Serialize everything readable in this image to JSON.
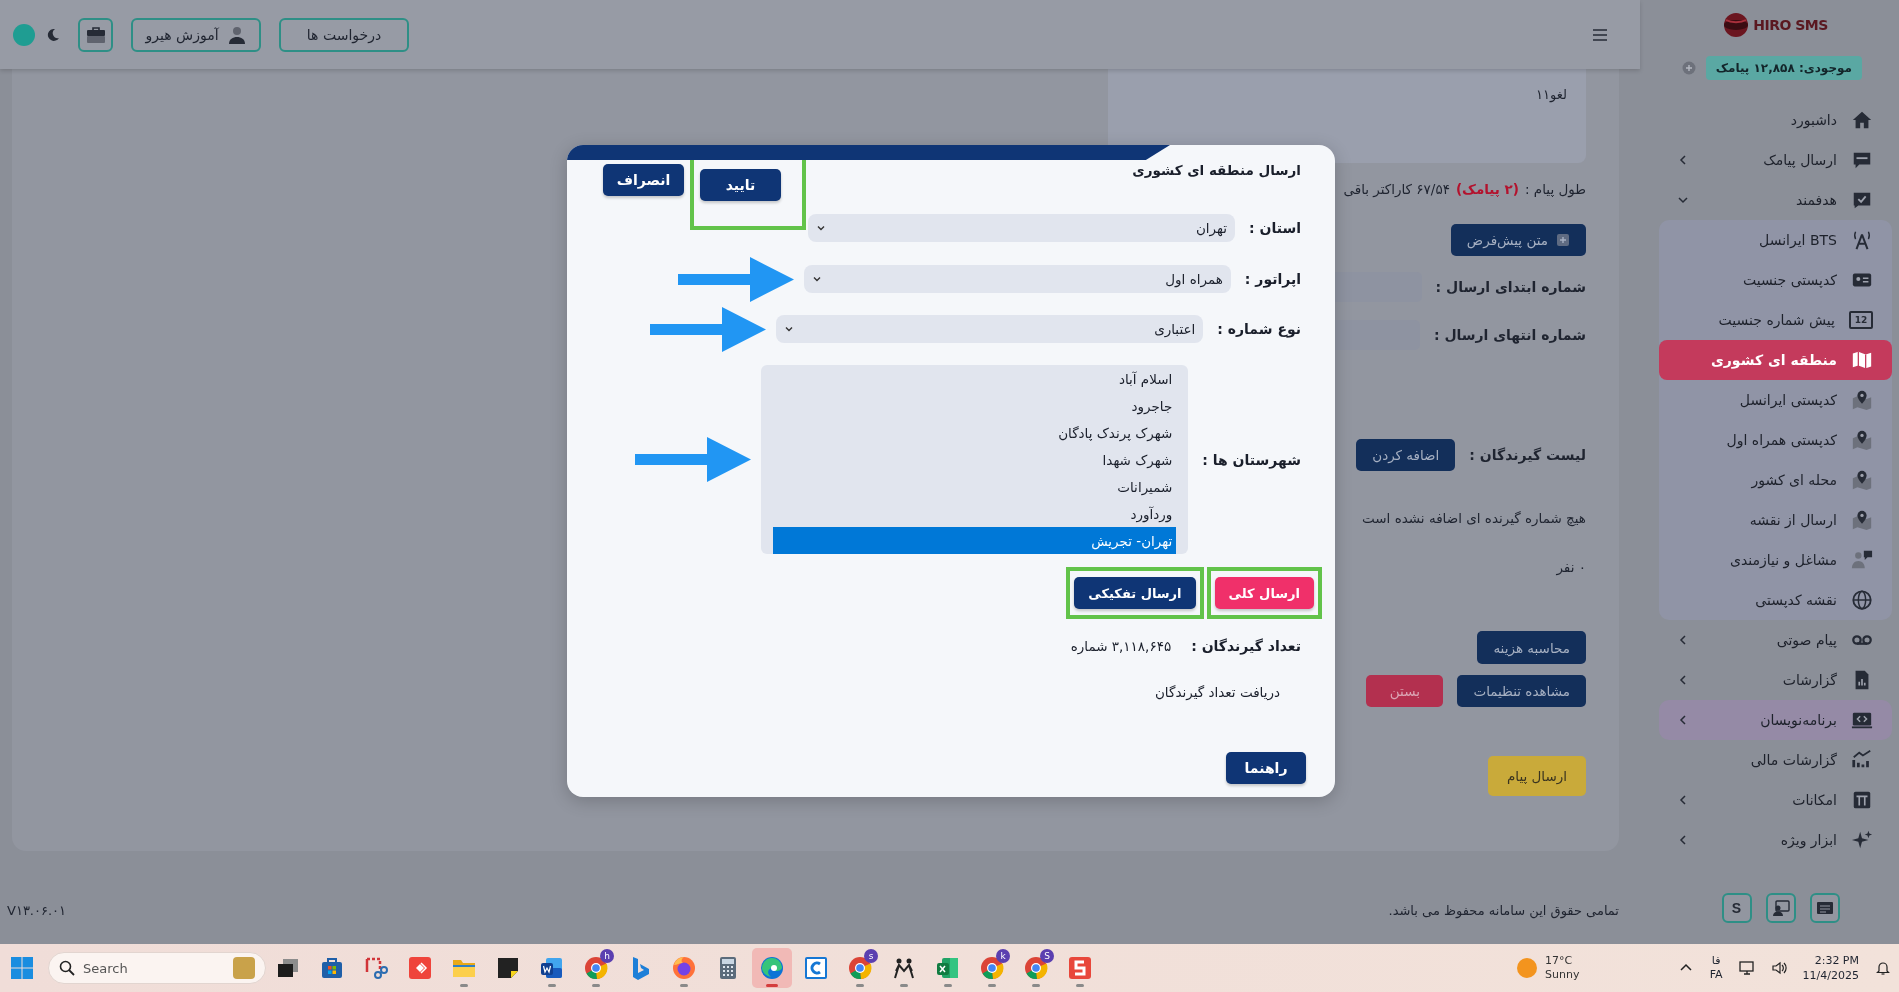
{
  "header": {
    "buttons": [
      {
        "kind": "text",
        "label": "درخواست ها"
      },
      {
        "kind": "user",
        "label": "آموزش هیرو"
      },
      {
        "kind": "briefcase"
      }
    ]
  },
  "sidebar": {
    "logo": "HIRO SMS",
    "balance": "موجودی: ۱۲,۸۵۸ پیامک",
    "items": [
      {
        "label": "داشبورد",
        "kind": "home",
        "submenu": false,
        "highlighted": false
      },
      {
        "label": "ارسال پیامک",
        "kind": "sms",
        "submenu": true,
        "expanded": false,
        "highlighted": false
      },
      {
        "label": "هدفمند",
        "kind": "check",
        "submenu": true,
        "expanded": true,
        "highlighted": false,
        "children": [
          {
            "label": "BTS ایرانسل",
            "kind": "antenna",
            "selected": false
          },
          {
            "label": "کدپستی جنسیت",
            "kind": "idcard",
            "selected": false
          },
          {
            "label": "پیش شماره جنسیت",
            "kind": "numcard",
            "badge": "12",
            "selected": false
          },
          {
            "label": "منطقه ای کشوری",
            "kind": "map",
            "selected": true
          },
          {
            "label": "کدپستی ایرانسل",
            "kind": "pinmap",
            "selected": false
          },
          {
            "label": "کدپستی همراه اول",
            "kind": "pinmap",
            "selected": false
          },
          {
            "label": "محله ای کشور",
            "kind": "pinmap",
            "selected": false
          },
          {
            "label": "ارسال از نقشه",
            "kind": "pinmap",
            "selected": false
          },
          {
            "label": "مشاغل و نیازمندی",
            "kind": "people",
            "selected": false
          },
          {
            "label": "نقشه کدپستی",
            "kind": "globe",
            "selected": false
          }
        ]
      },
      {
        "label": "پیام صوتی",
        "kind": "voicemail",
        "submenu": true,
        "expanded": false,
        "highlighted": false
      },
      {
        "label": "گزارشات",
        "kind": "report",
        "submenu": true,
        "expanded": false,
        "highlighted": false
      },
      {
        "label": "برنامه‌نویسان",
        "kind": "code",
        "submenu": true,
        "expanded": false,
        "highlighted": true
      },
      {
        "label": "گزارشات مالی",
        "kind": "chart",
        "submenu": false,
        "highlighted": false
      },
      {
        "label": "امکانات",
        "kind": "tools",
        "submenu": true,
        "expanded": false,
        "highlighted": false
      },
      {
        "label": "ابزار ویژه",
        "kind": "sparkle",
        "submenu": true,
        "expanded": false,
        "highlighted": false
      }
    ],
    "footer_buttons": [
      {
        "kind": "card"
      },
      {
        "kind": "contact"
      },
      {
        "kind": "letter",
        "label": "S"
      }
    ]
  },
  "content": {
    "message_text": "لغو۱۱",
    "length_label": "طول پیام :",
    "length_parts": "(۲ پیامک)",
    "length_remaining": "۶۷/۵۴ کاراکتر باقی",
    "default_text_button": "متن پیش‌فرض",
    "start_label": "شماره ابتدای ارسال :",
    "end_label": "شماره انتهای ارسال :",
    "recipients_label": "لیست گیرندگان :",
    "add_button": "اضافه کردن",
    "empty_message": "هیچ شماره گیرنده ای اضافه نشده است",
    "count": "۰ نفر",
    "calc_button": "محاسبه هزینه",
    "settings_button": "مشاهده تنظیمات",
    "close_button": "بستن",
    "send_button": "ارسال پیام"
  },
  "dialog": {
    "title": "ارسال منطقه ای کشوری",
    "actions": [
      {
        "label": "تایید",
        "annotated": true
      },
      {
        "label": "انصراف",
        "annotated": false
      }
    ],
    "fields": [
      {
        "label": "استان :",
        "value": "تهران",
        "arrow": false
      },
      {
        "label": "اپراتور :",
        "value": "همراه اول",
        "arrow": true
      },
      {
        "label": "نوع شماره :",
        "value": "اعتباری",
        "arrow": true
      }
    ],
    "cities": {
      "label": "شهرستان ها :",
      "arrow": true,
      "options": [
        {
          "label": "اسلام آباد",
          "selected": false
        },
        {
          "label": "جاجرود",
          "selected": false
        },
        {
          "label": "شهرک پرندک پادگان",
          "selected": false
        },
        {
          "label": "شهرک شهدا",
          "selected": false
        },
        {
          "label": "شمیرانات",
          "selected": false
        },
        {
          "label": "وردآورد",
          "selected": false
        },
        {
          "label": "تهران- تجریش",
          "selected": true
        }
      ]
    },
    "send_buttons": [
      {
        "label": "ارسال کلی",
        "kind": "accent",
        "annotated": true
      },
      {
        "label": "ارسال تفکیکی",
        "kind": "primary",
        "annotated": true
      }
    ],
    "recipients_label": "تعداد گیرندگان :",
    "recipients_value": "۳,۱۱۸,۶۴۵ شماره",
    "fetch_text": "دریافت تعداد گیرندگان",
    "help_button": "راهنما"
  },
  "footer": {
    "copyright": "تمامی حقوق این سامانه محفوظ می باشد.",
    "version": "V۱۳.۰۶.۰۱"
  },
  "taskbar": {
    "search": "Search",
    "apps": [
      {
        "kind": "brand",
        "running": true,
        "active": false
      },
      {
        "kind": "chrome",
        "badge": "S",
        "running": true,
        "active": false
      },
      {
        "kind": "chrome",
        "badge": "k",
        "running": true,
        "active": false
      },
      {
        "kind": "excel",
        "running": true,
        "active": false
      },
      {
        "kind": "people",
        "running": true,
        "active": false
      },
      {
        "kind": "chrome",
        "badge": "s",
        "running": true,
        "active": false
      },
      {
        "kind": "cbox",
        "running": false,
        "active": false
      },
      {
        "kind": "edge",
        "running": true,
        "active": true
      },
      {
        "kind": "calc",
        "running": false,
        "active": false
      },
      {
        "kind": "firefox",
        "running": true,
        "active": false
      },
      {
        "kind": "bing",
        "running": false,
        "active": false
      },
      {
        "kind": "chrome",
        "badge": "h",
        "running": true,
        "active": false
      },
      {
        "kind": "word",
        "running": true,
        "active": false
      },
      {
        "kind": "note",
        "running": false,
        "active": false
      },
      {
        "kind": "folder",
        "running": true,
        "active": false
      },
      {
        "kind": "remote",
        "running": false,
        "active": false
      },
      {
        "kind": "snip",
        "running": false,
        "active": false
      },
      {
        "kind": "store",
        "running": false,
        "active": false
      },
      {
        "kind": "taskview",
        "running": false,
        "active": false
      }
    ],
    "temperature": "17°C",
    "weather": "Sunny",
    "lang_script": "فا",
    "lang_code": "FA",
    "time": "2:32 PM",
    "date": "11/4/2025"
  }
}
